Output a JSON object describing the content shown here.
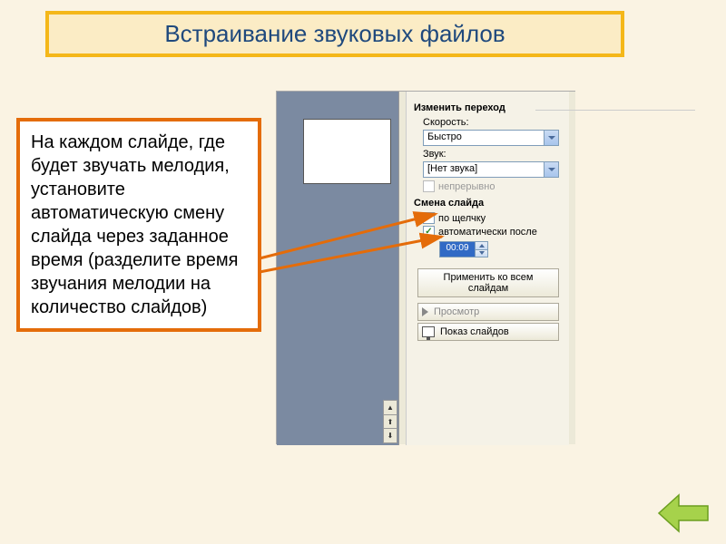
{
  "title": "Встраивание звуковых файлов",
  "instruction": "На каждом слайде, где будет звучать мелодия, установите автоматическую смену слайда через заданное время (разделите время звучания мелодии на количество слайдов)",
  "panel": {
    "heading": "Изменить переход",
    "speed_label": "Скорость:",
    "speed_value": "Быстро",
    "sound_label": "Звук:",
    "sound_value": "[Нет звука]",
    "loop_label": "непрерывно",
    "advance_heading": "Смена слайда",
    "on_click": "по щелчку",
    "auto_after": "автоматически после",
    "time_value": "00:09",
    "apply_all": "Применить ко всем слайдам",
    "play": "Просмотр",
    "slideshow": "Показ слайдов"
  },
  "colors": {
    "accent_orange": "#E46C0A",
    "accent_yellow": "#F4B719",
    "nav_green": "#A6D24B"
  }
}
